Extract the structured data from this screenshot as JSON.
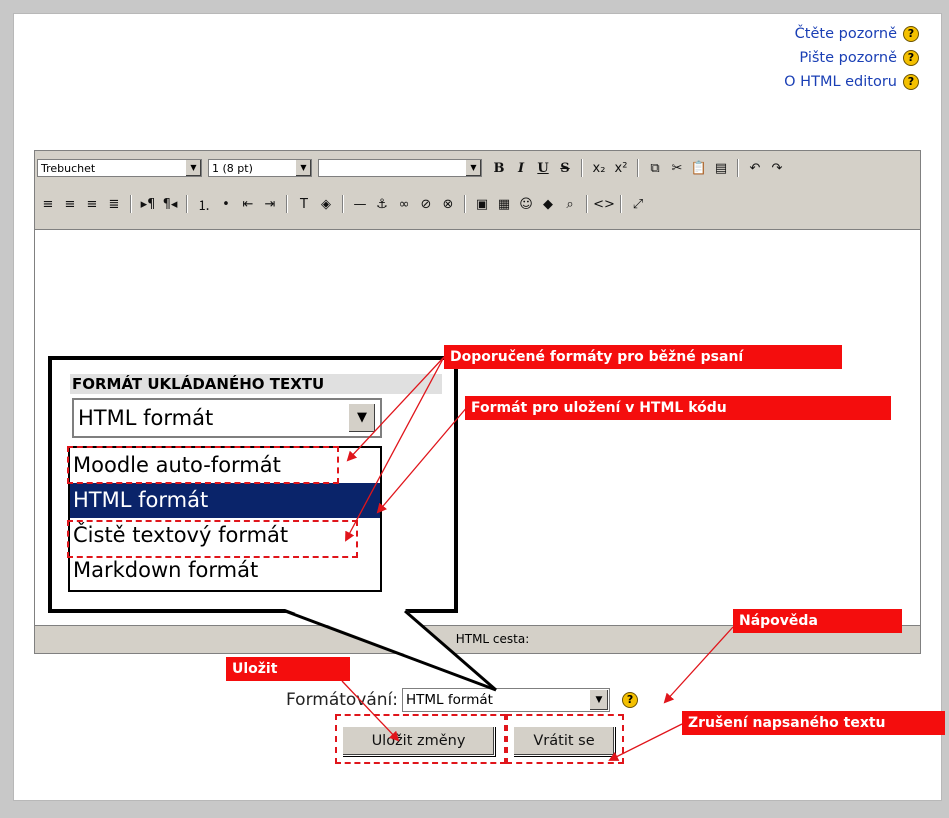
{
  "help_links": [
    {
      "label": "Čtěte pozorně",
      "icon": "help-icon"
    },
    {
      "label": "Pište pozorně",
      "icon": "help-icon"
    },
    {
      "label": "O HTML editoru",
      "icon": "help-icon"
    }
  ],
  "toolbar": {
    "font_family": "Trebuchet",
    "font_size": "1 (8 pt)",
    "paragraph": "",
    "row1_buttons": [
      {
        "glyph": "B",
        "icon": "bold-icon"
      },
      {
        "glyph": "I",
        "icon": "italic-icon"
      },
      {
        "glyph": "U",
        "icon": "underline-icon"
      },
      {
        "glyph": "S",
        "icon": "strikethrough-icon"
      },
      {
        "glyph": "x₂",
        "icon": "subscript-icon"
      },
      {
        "glyph": "x²",
        "icon": "superscript-icon"
      },
      {
        "glyph": "⧉",
        "icon": "copy-icon"
      },
      {
        "glyph": "✂",
        "icon": "cut-icon"
      },
      {
        "glyph": "📋",
        "icon": "paste-icon"
      },
      {
        "glyph": "▤",
        "icon": "clean-word-icon"
      },
      {
        "glyph": "↶",
        "icon": "undo-icon"
      },
      {
        "glyph": "↷",
        "icon": "redo-icon"
      }
    ],
    "row2_buttons": [
      {
        "glyph": "≡",
        "icon": "align-left-icon"
      },
      {
        "glyph": "≡",
        "icon": "align-center-icon"
      },
      {
        "glyph": "≡",
        "icon": "align-right-icon"
      },
      {
        "glyph": "≣",
        "icon": "justify-icon"
      },
      {
        "glyph": "▸¶",
        "icon": "ltr-icon"
      },
      {
        "glyph": "¶◂",
        "icon": "rtl-icon"
      },
      {
        "glyph": "⒈",
        "icon": "ordered-list-icon"
      },
      {
        "glyph": "•",
        "icon": "unordered-list-icon"
      },
      {
        "glyph": "⇤",
        "icon": "outdent-icon"
      },
      {
        "glyph": "⇥",
        "icon": "indent-icon"
      },
      {
        "glyph": "T",
        "icon": "text-color-icon"
      },
      {
        "glyph": "◈",
        "icon": "highlight-color-icon"
      },
      {
        "glyph": "—",
        "icon": "horizontal-rule-icon"
      },
      {
        "glyph": "⚓",
        "icon": "anchor-icon"
      },
      {
        "glyph": "∞",
        "icon": "link-icon"
      },
      {
        "glyph": "⊘",
        "icon": "unlink-icon"
      },
      {
        "glyph": "⊗",
        "icon": "nolink-icon"
      },
      {
        "glyph": "▣",
        "icon": "image-icon"
      },
      {
        "glyph": "▦",
        "icon": "table-icon"
      },
      {
        "glyph": "☺",
        "icon": "smiley-icon"
      },
      {
        "glyph": "◆",
        "icon": "special-char-icon"
      },
      {
        "glyph": "⌕",
        "icon": "search-replace-icon"
      },
      {
        "glyph": "<>",
        "icon": "html-source-icon"
      },
      {
        "glyph": "⤢",
        "icon": "fullscreen-icon"
      }
    ]
  },
  "path_bar": "HTML cesta:",
  "callout": {
    "title": "FORMÁT UKLÁDANÉHO TEXTU",
    "selected": "HTML formát",
    "options": [
      "Moodle auto-formát",
      "HTML formát",
      "Čistě textový formát",
      "Markdown formát"
    ]
  },
  "annotations": {
    "recommended": "Doporučené formáty pro běžné psaní",
    "html_format": "Formát pro uložení v HTML kódu",
    "help": "Nápověda",
    "save": "Uložit",
    "cancel": "Zrušení napsaného  textu"
  },
  "format_row": {
    "label": "Formátování:",
    "value": "HTML formát"
  },
  "buttons": {
    "save": "Uložit změny",
    "back": "Vrátit se"
  },
  "colors": {
    "annotation_red": "#f40d0d",
    "selection_blue": "#0a246a",
    "link_blue": "#1a3fb5"
  }
}
